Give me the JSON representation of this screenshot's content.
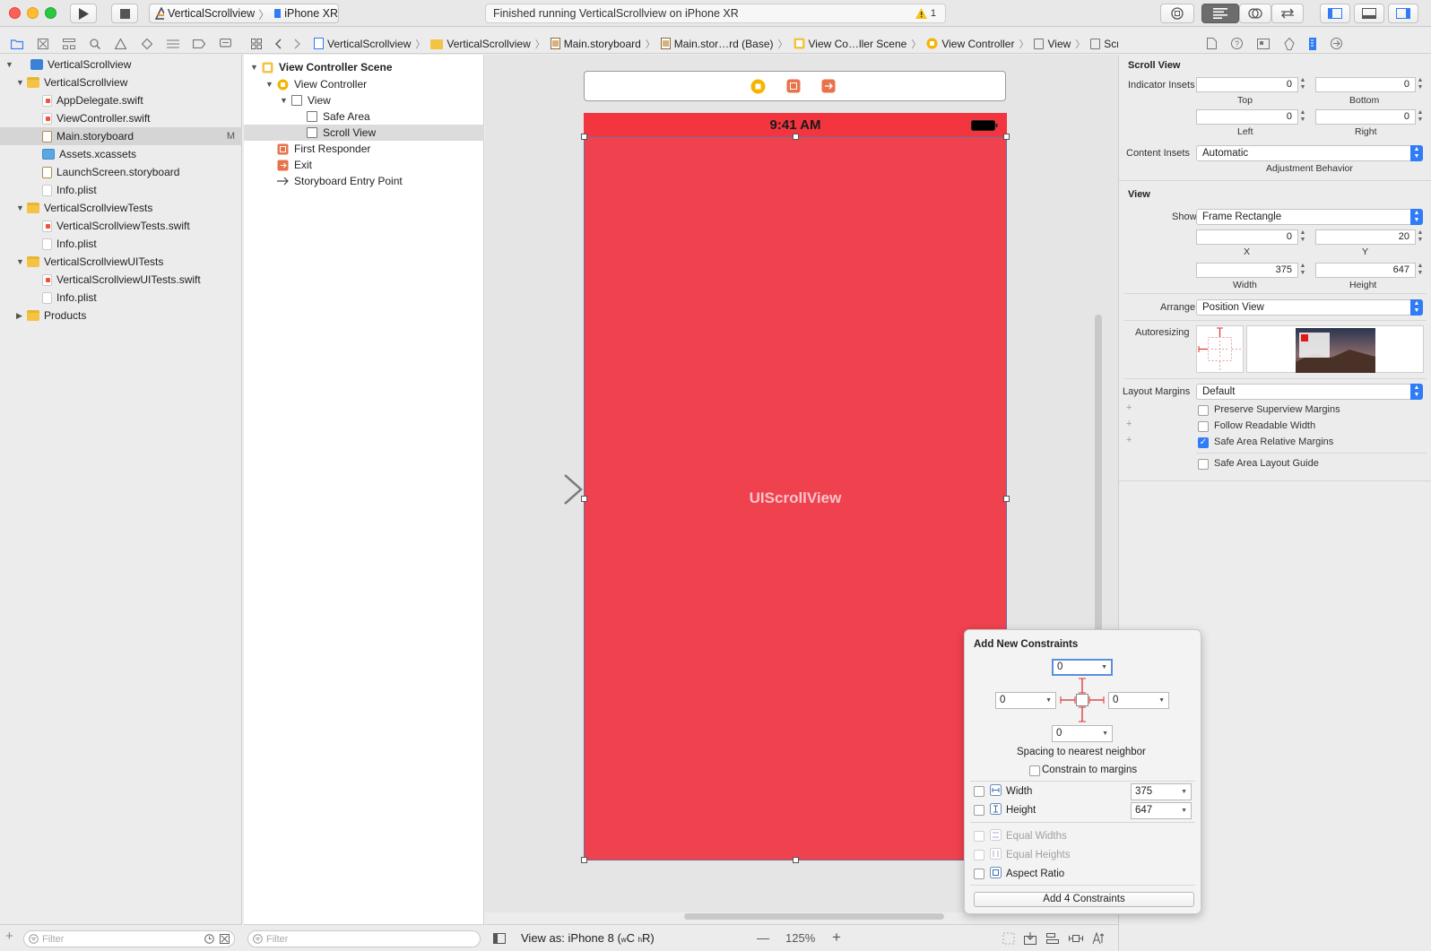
{
  "toolbar": {
    "scheme_target": "VerticalScrollview",
    "scheme_device": "iPhone XR",
    "activity_text": "Finished running VerticalScrollview on iPhone XR",
    "warning_count": "1"
  },
  "navigator": {
    "items": [
      {
        "label": "VerticalScrollview",
        "badge": ""
      },
      {
        "label": "VerticalScrollview",
        "badge": ""
      },
      {
        "label": "AppDelegate.swift",
        "badge": ""
      },
      {
        "label": "ViewController.swift",
        "badge": ""
      },
      {
        "label": "Main.storyboard",
        "badge": "M"
      },
      {
        "label": "Assets.xcassets",
        "badge": ""
      },
      {
        "label": "LaunchScreen.storyboard",
        "badge": ""
      },
      {
        "label": "Info.plist",
        "badge": ""
      },
      {
        "label": "VerticalScrollviewTests",
        "badge": ""
      },
      {
        "label": "VerticalScrollviewTests.swift",
        "badge": ""
      },
      {
        "label": "Info.plist",
        "badge": ""
      },
      {
        "label": "VerticalScrollviewUITests",
        "badge": ""
      },
      {
        "label": "VerticalScrollviewUITests.swift",
        "badge": ""
      },
      {
        "label": "Info.plist",
        "badge": ""
      },
      {
        "label": "Products",
        "badge": ""
      }
    ],
    "filter_placeholder": "Filter"
  },
  "jumpbar": {
    "crumbs": [
      "VerticalScrollview",
      "VerticalScrollview",
      "Main.storyboard",
      "Main.stor…rd (Base)",
      "View Co…ller Scene",
      "View Controller",
      "View",
      "Scroll View"
    ]
  },
  "outline": {
    "items": [
      {
        "label": "View Controller Scene"
      },
      {
        "label": "View Controller"
      },
      {
        "label": "View"
      },
      {
        "label": "Safe Area"
      },
      {
        "label": "Scroll View"
      },
      {
        "label": "First Responder"
      },
      {
        "label": "Exit"
      },
      {
        "label": "Storyboard Entry Point"
      }
    ],
    "filter_placeholder": "Filter"
  },
  "canvas": {
    "status_time": "9:41 AM",
    "view_label": "UIScrollView",
    "view_as": "View as: iPhone 8 (",
    "view_as_w": "w",
    "view_as_c": "C ",
    "view_as_h": "h",
    "view_as_r": "R)",
    "zoom_minus": "—",
    "zoom": "125%",
    "zoom_plus": "+"
  },
  "inspector": {
    "scroll_view_header": "Scroll View",
    "indicator_insets_label": "Indicator Insets",
    "top_value": "0",
    "top_label": "Top",
    "bottom_value": "0",
    "bottom_label": "Bottom",
    "left_value": "0",
    "left_label": "Left",
    "right_value": "0",
    "right_label": "Right",
    "content_insets_label": "Content Insets",
    "content_insets_value": "Automatic",
    "adjustment_behavior": "Adjustment Behavior",
    "view_header": "View",
    "show_label": "Show",
    "show_value": "Frame Rectangle",
    "x_value": "0",
    "x_label": "X",
    "y_value": "20",
    "y_label": "Y",
    "width_value": "375",
    "width_label": "Width",
    "height_value": "647",
    "height_label": "Height",
    "arrange_label": "Arrange",
    "arrange_value": "Position View",
    "autoresizing_label": "Autoresizing",
    "layout_margins_label": "Layout Margins",
    "layout_margins_value": "Default",
    "preserve_superview_margins": "Preserve Superview Margins",
    "follow_readable_width": "Follow Readable Width",
    "safe_area_relative_margins": "Safe Area Relative Margins",
    "safe_area_layout_guide": "Safe Area Layout Guide",
    "plus": "+"
  },
  "constraints": {
    "title": "Add New Constraints",
    "top": "0",
    "left": "0",
    "right": "0",
    "bottom": "0",
    "spacing_caption": "Spacing to nearest neighbor",
    "constrain_to_margins": "Constrain to margins",
    "width_label": "Width",
    "width_value": "375",
    "height_label": "Height",
    "height_value": "647",
    "equal_widths": "Equal Widths",
    "equal_heights": "Equal Heights",
    "aspect_ratio": "Aspect Ratio",
    "add_button": "Add 4 Constraints"
  },
  "colors": {
    "scroll_view_fill": "#f0414e",
    "accent": "#2f7cf6"
  }
}
